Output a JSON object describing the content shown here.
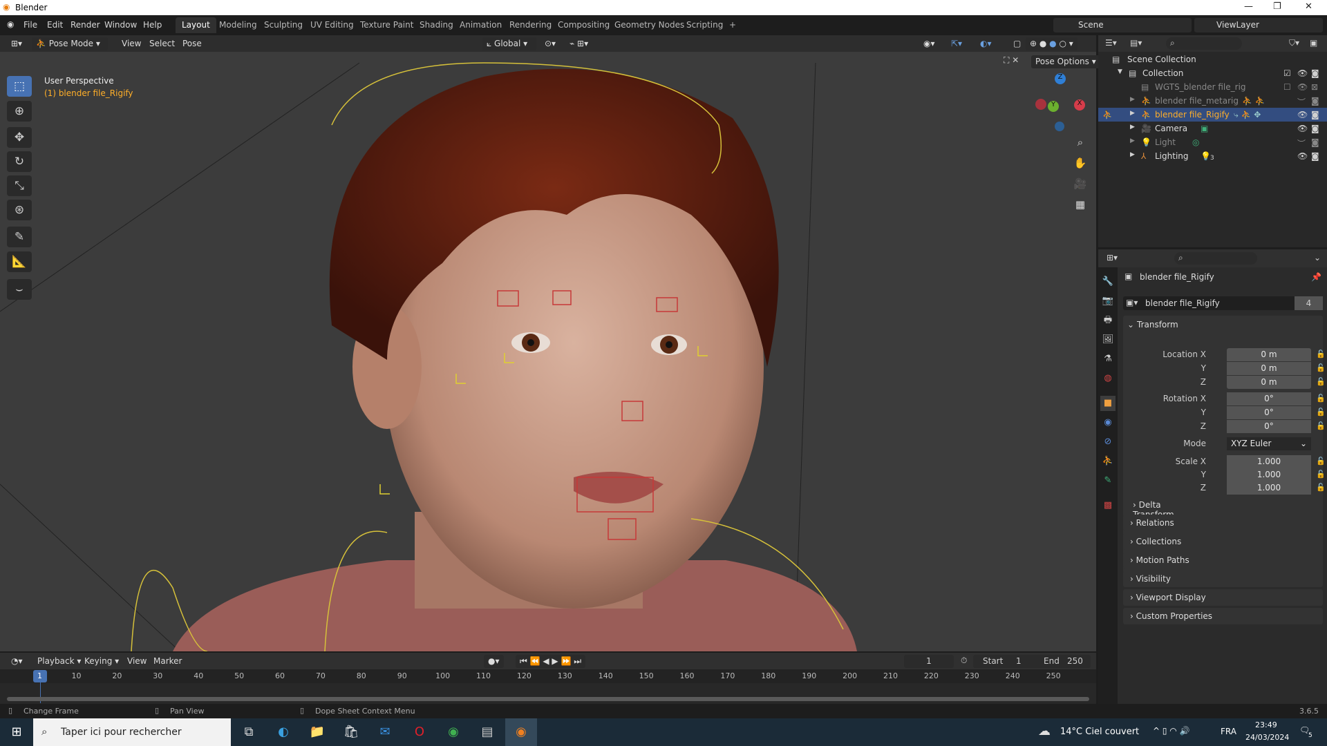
{
  "window": {
    "title": "Blender"
  },
  "menu": [
    "File",
    "Edit",
    "Render",
    "Window",
    "Help"
  ],
  "workspaces": [
    "Layout",
    "Modeling",
    "Sculpting",
    "UV Editing",
    "Texture Paint",
    "Shading",
    "Animation",
    "Rendering",
    "Compositing",
    "Geometry Nodes",
    "Scripting",
    "+"
  ],
  "active_workspace": "Layout",
  "scene": {
    "name": "Scene",
    "view_layer": "ViewLayer"
  },
  "viewport": {
    "mode": "Pose Mode",
    "menus": [
      "View",
      "Select",
      "Pose"
    ],
    "orientation": "Global",
    "pose_options": "Pose Options",
    "overlay_title": "User Perspective",
    "overlay_object": "(1) blender file_Rigify",
    "gizmo": {
      "x": "X",
      "y": "Y",
      "z": "Z"
    }
  },
  "outliner": {
    "root": "Scene Collection",
    "items": [
      {
        "name": "Collection",
        "level": 1
      },
      {
        "name": "WGTS_blender file_rig",
        "level": 2
      },
      {
        "name": "blender file_metarig",
        "level": 2
      },
      {
        "name": "blender file_Rigify",
        "level": 2,
        "selected": true
      },
      {
        "name": "Camera",
        "level": 2
      },
      {
        "name": "Light",
        "level": 2
      },
      {
        "name": "Lighting",
        "level": 2,
        "badge": "3"
      }
    ]
  },
  "properties": {
    "object_name": "blender file_Rigify",
    "data_name": "blender file_Rigify",
    "users": "4",
    "transform_title": "Transform",
    "location": {
      "label": "Location X",
      "x": "0 m",
      "y": "0 m",
      "z": "0 m"
    },
    "rotation": {
      "label": "Rotation X",
      "x": "0°",
      "y": "0°",
      "z": "0°"
    },
    "mode_label": "Mode",
    "mode": "XYZ Euler",
    "scale": {
      "label": "Scale X",
      "x": "1.000",
      "y": "1.000",
      "z": "1.000"
    },
    "axis": {
      "y": "Y",
      "z": "Z"
    },
    "delta": "Delta Transform",
    "panels": [
      "Relations",
      "Collections",
      "Motion Paths",
      "Visibility",
      "Viewport Display",
      "Custom Properties"
    ]
  },
  "timeline": {
    "menus": [
      "Playback",
      "Keying",
      "View",
      "Marker"
    ],
    "current_frame": "1",
    "start_label": "Start",
    "start": "1",
    "end_label": "End",
    "end": "250",
    "ticks": [
      10,
      20,
      30,
      40,
      50,
      60,
      70,
      80,
      90,
      100,
      110,
      120,
      130,
      140,
      150,
      160,
      170,
      180,
      190,
      200,
      210,
      220,
      230,
      240,
      250
    ],
    "playhead": 1
  },
  "status": {
    "change_frame": "Change Frame",
    "pan_view": "Pan View",
    "context_menu": "Dope Sheet Context Menu",
    "version": "3.6.5"
  },
  "taskbar": {
    "search_placeholder": "Taper ici pour rechercher",
    "weather": "14°C  Ciel couvert",
    "lang": "FRA",
    "time": "23:49",
    "date": "24/03/2024",
    "notifications": "5"
  },
  "colors": {
    "accent": "#4772b3",
    "selected_text": "#ffaf29",
    "taskbar": "#1b2b38"
  }
}
